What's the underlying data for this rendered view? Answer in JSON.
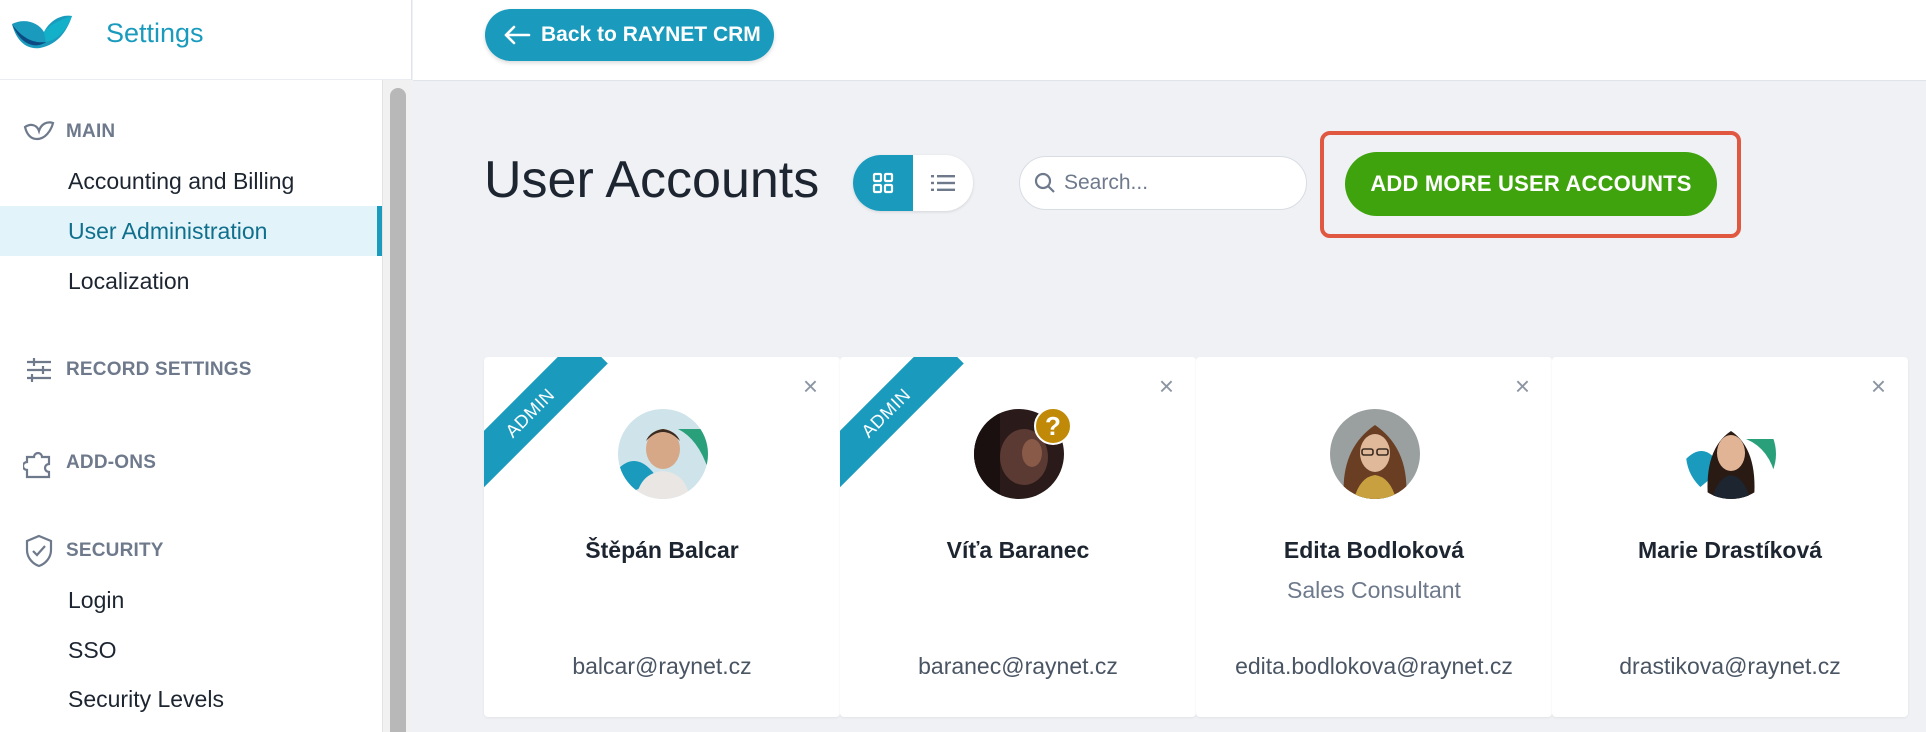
{
  "app": {
    "title": "Settings",
    "logo_icon": "raynet-logo-icon"
  },
  "colors": {
    "accent": "#1a9bbd",
    "primary_action": "#3fa30e",
    "highlight_border": "#e0583f",
    "badge": "#c08a08"
  },
  "topbar": {
    "back_label": "Back to RAYNET CRM"
  },
  "sidebar": {
    "sections": [
      {
        "label": "MAIN",
        "icon": "bird-icon",
        "items": [
          "Accounting and Billing",
          "User Administration",
          "Localization"
        ]
      },
      {
        "label": "RECORD SETTINGS",
        "icon": "sliders-icon",
        "items": []
      },
      {
        "label": "ADD-ONS",
        "icon": "puzzle-icon",
        "items": []
      },
      {
        "label": "SECURITY",
        "icon": "shield-icon",
        "items": [
          "Login",
          "SSO",
          "Security Levels"
        ]
      }
    ],
    "active_item": "User Administration"
  },
  "main": {
    "title": "User Accounts",
    "search_placeholder": "Search...",
    "add_button": "ADD MORE USER ACCOUNTS",
    "view_modes": [
      "grid",
      "list"
    ],
    "active_view": "grid"
  },
  "users": [
    {
      "name": "Štěpán Balcar",
      "role": "",
      "email": "balcar@raynet.cz",
      "ribbon": "ADMIN",
      "badge": ""
    },
    {
      "name": "Víťa Baranec",
      "role": "",
      "email": "baranec@raynet.cz",
      "ribbon": "ADMIN",
      "badge": "?"
    },
    {
      "name": "Edita Bodloková",
      "role": "Sales Consultant",
      "email": "edita.bodlokova@raynet.cz",
      "ribbon": "",
      "badge": ""
    },
    {
      "name": "Marie Drastíková",
      "role": "",
      "email": "drastikova@raynet.cz",
      "ribbon": "",
      "badge": ""
    }
  ]
}
